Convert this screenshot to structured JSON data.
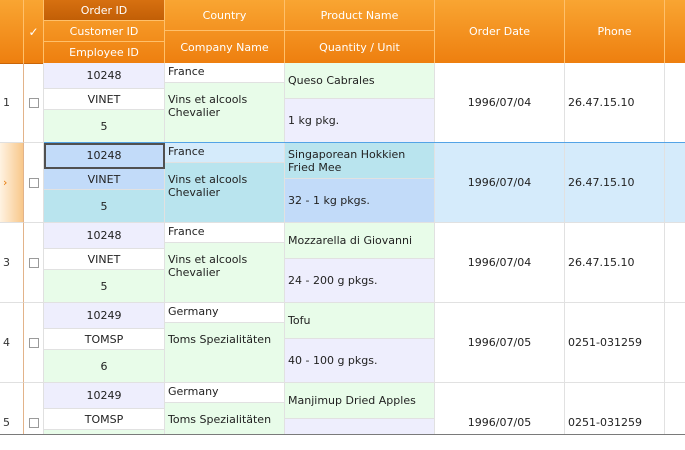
{
  "header": {
    "order_id": "Order ID",
    "customer_id": "Customer ID",
    "employee_id": "Employee ID",
    "country": "Country",
    "company_name": "Company Name",
    "product_name": "Product Name",
    "quantity_unit": "Quantity / Unit",
    "order_date": "Order Date",
    "phone": "Phone",
    "select_all_glyph": "✓"
  },
  "rows": [
    {
      "indicator": "1",
      "order_id": "10248",
      "customer_id": "VINET",
      "employee_id": "5",
      "country": "France",
      "company": "Vins et alcools Chevalier",
      "product": "Queso Cabrales",
      "quantity": "1 kg pkg.",
      "date": "1996/07/04",
      "phone": "26.47.15.10"
    },
    {
      "indicator": "›",
      "order_id": "10248",
      "customer_id": "VINET",
      "employee_id": "5",
      "country": "France",
      "company": "Vins et alcools Chevalier",
      "product": "Singaporean Hokkien Fried Mee",
      "quantity": "32 - 1 kg pkgs.",
      "date": "1996/07/04",
      "phone": "26.47.15.10"
    },
    {
      "indicator": "3",
      "order_id": "10248",
      "customer_id": "VINET",
      "employee_id": "5",
      "country": "France",
      "company": "Vins et alcools Chevalier",
      "product": "Mozzarella di Giovanni",
      "quantity": "24 - 200 g pkgs.",
      "date": "1996/07/04",
      "phone": "26.47.15.10"
    },
    {
      "indicator": "4",
      "order_id": "10249",
      "customer_id": "TOMSP",
      "employee_id": "6",
      "country": "Germany",
      "company": "Toms Spezialitäten",
      "product": "Tofu",
      "quantity": "40 - 100 g pkgs.",
      "date": "1996/07/05",
      "phone": "0251-031259"
    },
    {
      "indicator": "5",
      "order_id": "10249",
      "customer_id": "TOMSP",
      "employee_id": "",
      "country": "Germany",
      "company": "Toms Spezialitäten",
      "product": "Manjimup Dried Apples",
      "quantity": "",
      "date": "1996/07/05",
      "phone": "0251-031259"
    }
  ],
  "selected_row_index": 1,
  "colors": {
    "header_top": "#f9a532",
    "header_bottom": "#ee7f0f",
    "selection": "#d5ebfb",
    "selection_border": "#53a3e6",
    "lavender": "#eeeefd",
    "mint": "#e8fce9"
  }
}
